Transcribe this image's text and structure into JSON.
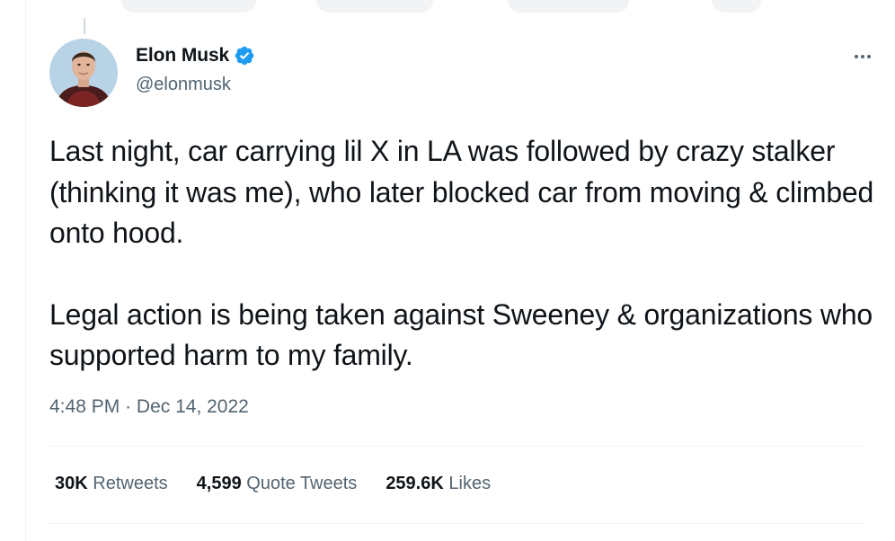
{
  "author": {
    "name": "Elon Musk",
    "handle": "@elonmusk",
    "verified": true,
    "verified_color": "#1d9bf0"
  },
  "menu_icon": "more-horizontal-icon",
  "tweet": {
    "paragraphs": [
      "Last night, car carrying lil X in LA was followed by crazy stalker (thinking it was me), who later blocked car from moving & climbed onto hood.",
      "Legal action is being taken against Sweeney & organizations who supported harm to my family."
    ],
    "time": "4:48 PM",
    "separator": "·",
    "date": "Dec 14, 2022"
  },
  "stats": {
    "retweets": {
      "count": "30K",
      "label": "Retweets"
    },
    "quote_tweets": {
      "count": "4,599",
      "label": "Quote Tweets"
    },
    "likes": {
      "count": "259.6K",
      "label": "Likes"
    }
  },
  "colors": {
    "text": "#0f1419",
    "secondary": "#536471",
    "divider": "#eff3f4",
    "accent": "#1d9bf0"
  }
}
